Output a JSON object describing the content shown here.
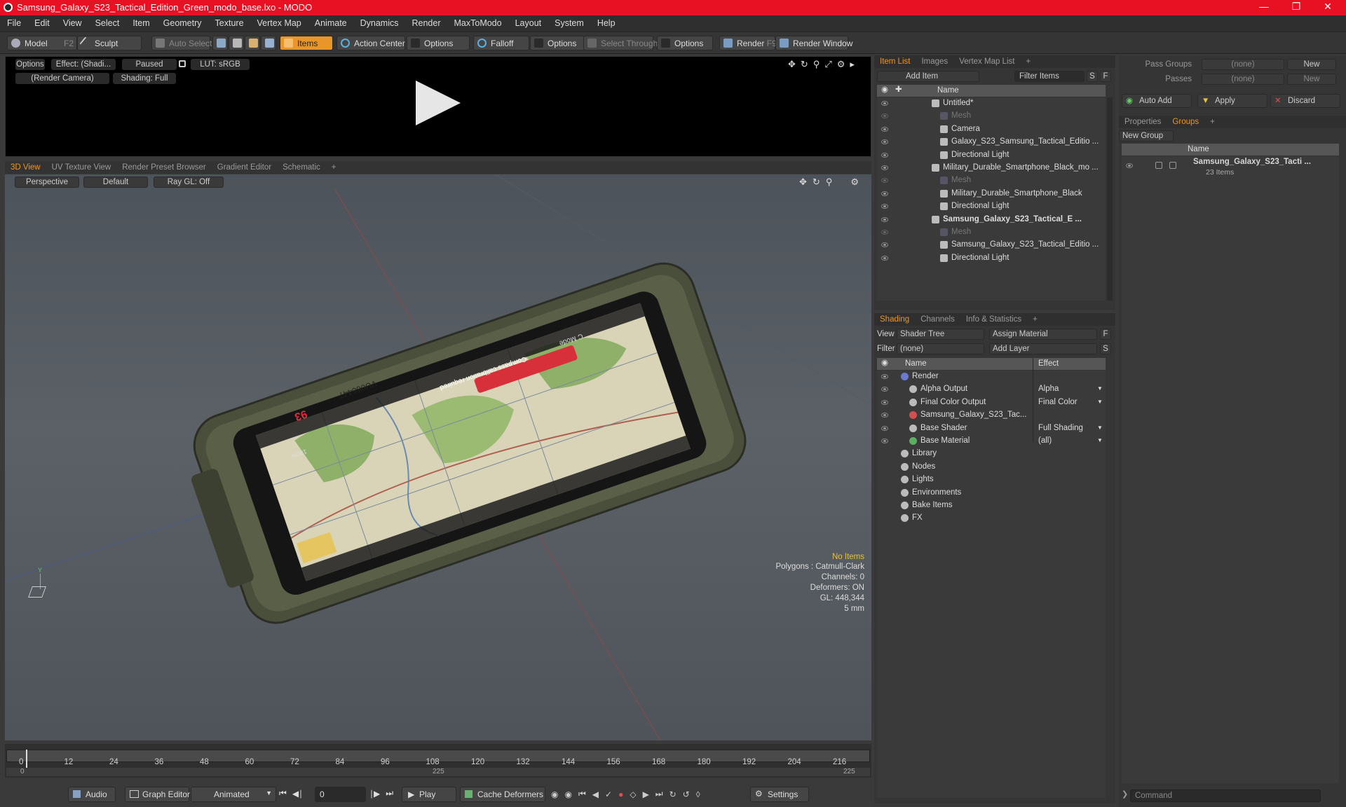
{
  "window": {
    "title": "Samsung_Galaxy_S23_Tactical_Edition_Green_modo_base.lxo - MODO"
  },
  "menu": [
    "File",
    "Edit",
    "View",
    "Select",
    "Item",
    "Geometry",
    "Texture",
    "Vertex Map",
    "Animate",
    "Dynamics",
    "Render",
    "MaxToModo",
    "Layout",
    "System",
    "Help"
  ],
  "toolbar": {
    "model": "Model",
    "model_key": "F2",
    "sculpt": "Sculpt",
    "auto_select": "Auto Select",
    "items": "Items",
    "action_center": "Action Center",
    "options1": "Options",
    "falloff": "Falloff",
    "options2": "Options",
    "select_through": "Select Through",
    "options3": "Options",
    "render": "Render",
    "render_key": "F9",
    "render_window": "Render Window"
  },
  "preview": {
    "options": "Options",
    "effect": "Effect: (Shadi...",
    "paused": "Paused",
    "lut": "LUT: sRGB",
    "camera": "(Render Camera)",
    "shading": "Shading: Full"
  },
  "viewport": {
    "tabs": [
      "3D View",
      "UV Texture View",
      "Render Preset Browser",
      "Gradient Editor",
      "Schematic"
    ],
    "perspective": "Perspective",
    "default": "Default",
    "raygl": "Ray GL: Off",
    "stats": {
      "no_items": "No Items",
      "polygons": "Polygons : Catmull-Clark",
      "channels": "Channels: 0",
      "deformers": "Deformers: ON",
      "gl": "GL: 448,344",
      "scale": "5 mm"
    },
    "screen": {
      "warning": "Compass calibration required",
      "code": "VU066447",
      "mode": "C Mode",
      "num": "93",
      "batt": "100%"
    }
  },
  "timeline": {
    "ticks": [
      "0",
      "12",
      "24",
      "36",
      "48",
      "60",
      "72",
      "84",
      "96",
      "108",
      "120",
      "132",
      "144",
      "156",
      "168",
      "180",
      "192",
      "204",
      "216"
    ],
    "sub": [
      "0",
      "225",
      "225"
    ]
  },
  "bottombar": {
    "audio": "Audio",
    "graph_editor": "Graph Editor",
    "animated": "Animated",
    "frame": "0",
    "play": "Play",
    "cache": "Cache Deformers",
    "settings": "Settings"
  },
  "itemlist": {
    "tabs": [
      "Item List",
      "Images",
      "Vertex Map List"
    ],
    "add_item": "Add Item",
    "filter": "Filter Items",
    "s": "S",
    "f": "F",
    "name_col": "Name",
    "rows": [
      {
        "label": "Untitled*",
        "bold": false,
        "dim": false
      },
      {
        "label": "Mesh",
        "bold": false,
        "dim": true
      },
      {
        "label": "Camera",
        "bold": false,
        "dim": false
      },
      {
        "label": "Galaxy_S23_Samsung_Tactical_Editio ...",
        "bold": false,
        "dim": false
      },
      {
        "label": "Directional Light",
        "bold": false,
        "dim": false
      },
      {
        "label": "Military_Durable_Smartphone_Black_mo ...",
        "bold": false,
        "dim": false
      },
      {
        "label": "Mesh",
        "bold": false,
        "dim": true
      },
      {
        "label": "Military_Durable_Smartphone_Black",
        "bold": false,
        "dim": false
      },
      {
        "label": "Directional Light",
        "bold": false,
        "dim": false
      },
      {
        "label": "Samsung_Galaxy_S23_Tactical_E ...",
        "bold": true,
        "dim": false
      },
      {
        "label": "Mesh",
        "bold": false,
        "dim": true
      },
      {
        "label": "Samsung_Galaxy_S23_Tactical_Editio ...",
        "bold": false,
        "dim": false
      },
      {
        "label": "Directional Light",
        "bold": false,
        "dim": false
      }
    ]
  },
  "shading": {
    "tabs": [
      "Shading",
      "Channels",
      "Info & Statistics"
    ],
    "view_label": "View",
    "view_value": "Shader Tree",
    "assign": "Assign Material",
    "f": "F",
    "filter_label": "Filter",
    "filter_value": "(none)",
    "add_layer": "Add Layer",
    "s": "S",
    "col_name": "Name",
    "col_effect": "Effect",
    "rows": [
      {
        "label": "Render",
        "effect": ""
      },
      {
        "label": "Alpha Output",
        "effect": "Alpha"
      },
      {
        "label": "Final Color Output",
        "effect": "Final Color"
      },
      {
        "label": "Samsung_Galaxy_S23_Tac...",
        "effect": ""
      },
      {
        "label": "Base Shader",
        "effect": "Full Shading"
      },
      {
        "label": "Base Material",
        "effect": "(all)"
      },
      {
        "label": "Library",
        "effect": ""
      },
      {
        "label": "Nodes",
        "effect": ""
      },
      {
        "label": "Lights",
        "effect": ""
      },
      {
        "label": "Environments",
        "effect": ""
      },
      {
        "label": "Bake Items",
        "effect": ""
      },
      {
        "label": "FX",
        "effect": ""
      }
    ]
  },
  "groups": {
    "pass_groups": "Pass Groups",
    "pass_value": "(none)",
    "new1": "New",
    "passes": "Passes",
    "passes_value": "(none)",
    "new2": "New",
    "auto_add": "Auto Add",
    "apply": "Apply",
    "discard": "Discard",
    "tabs": [
      "Properties",
      "Groups"
    ],
    "new_group": "New Group",
    "name_col": "Name",
    "item_name": "Samsung_Galaxy_S23_Tacti ...",
    "item_count": "23 Items",
    "command": "Command"
  },
  "colors": {
    "accent": "#e8962a",
    "title_bg": "#e81123"
  }
}
